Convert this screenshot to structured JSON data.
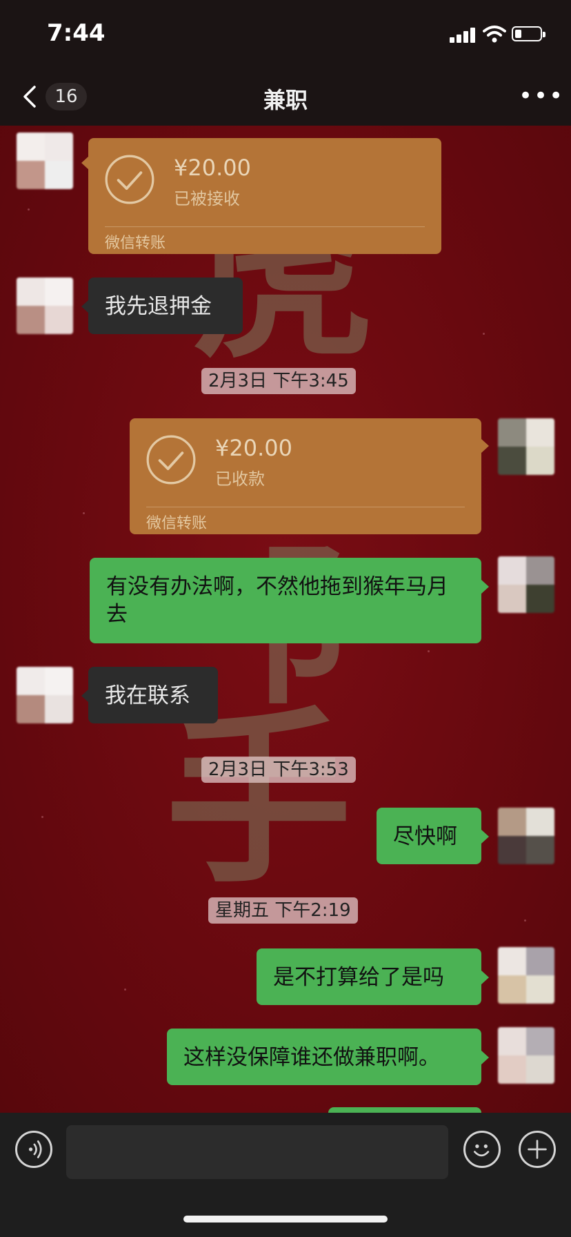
{
  "status_bar": {
    "time": "7:44"
  },
  "nav": {
    "back_count": "16",
    "title": "兼职",
    "more_label": "•••"
  },
  "messages": {
    "m1": {
      "amount": "¥20.00",
      "state": "已被接收",
      "source": "微信转账"
    },
    "m2": {
      "text": "我先退押金"
    },
    "ts1": "2月3日 下午3:45",
    "m3": {
      "amount": "¥20.00",
      "state": "已收款",
      "source": "微信转账"
    },
    "m4": {
      "text": "有没有办法啊，不然他拖到猴年马月去"
    },
    "m5": {
      "text": "我在联系"
    },
    "ts2": "2月3日 下午3:53",
    "m6": {
      "text": "尽快啊"
    },
    "ts3": "星期五 下午2:19",
    "m7": {
      "text": "是不打算给了是吗"
    },
    "m8": {
      "text": "这样没保障谁还做兼职啊。"
    }
  },
  "colors": {
    "chat_bg": "#6b0a10",
    "green_bubble": "#4bb254",
    "transfer": "#b47437",
    "dark_bubble": "#2c2c2c"
  },
  "icons": {
    "back": "chevron-left-icon",
    "more": "more-dots-icon",
    "voice": "voice-icon",
    "emoji": "emoji-icon",
    "plus": "plus-icon",
    "check": "check-icon"
  },
  "input": {
    "placeholder": ""
  }
}
